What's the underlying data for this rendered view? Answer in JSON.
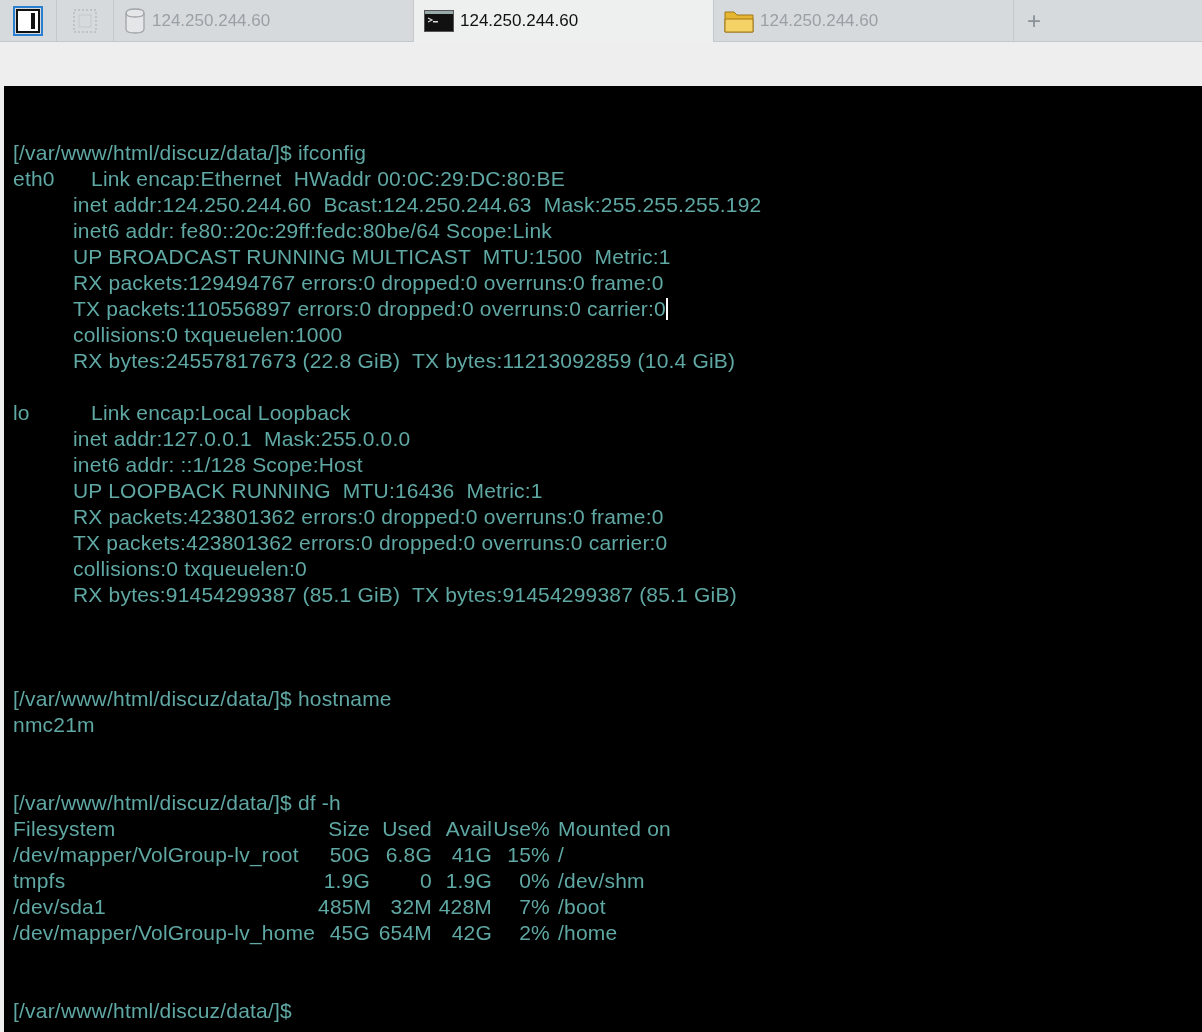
{
  "toolbar": [
    {
      "kind": "panel",
      "selected": true
    },
    {
      "kind": "select",
      "selected": false
    }
  ],
  "tabs": [
    {
      "kind": "database",
      "label": "124.250.244.60",
      "selected": false
    },
    {
      "kind": "terminal",
      "label": "124.250.244.60",
      "selected": true
    },
    {
      "kind": "folder",
      "label": "124.250.244.60",
      "selected": false
    }
  ],
  "new_tab": "+",
  "terminal": {
    "lines": [
      {
        "kind": "prompt",
        "prompt": "[/var/www/html/discuz/data/]$",
        "command": "ifconfig"
      },
      {
        "kind": "iface",
        "name": "eth0",
        "text": "Link encap:Ethernet  HWaddr 00:0C:29:DC:80:BE"
      },
      {
        "kind": "detail",
        "text": "inet addr:124.250.244.60  Bcast:124.250.244.63  Mask:255.255.255.192"
      },
      {
        "kind": "detail",
        "text": "inet6 addr: fe80::20c:29ff:fedc:80be/64 Scope:Link"
      },
      {
        "kind": "detail",
        "text": "UP BROADCAST RUNNING MULTICAST  MTU:1500  Metric:1"
      },
      {
        "kind": "detail",
        "text": "RX packets:129494767 errors:0 dropped:0 overruns:0 frame:0"
      },
      {
        "kind": "detail",
        "text": "TX packets:110556897 errors:0 dropped:0 overruns:0 carrier:0",
        "cursor": true
      },
      {
        "kind": "detail",
        "text": "collisions:0 txqueuelen:1000"
      },
      {
        "kind": "detail",
        "text": "RX bytes:24557817673 (22.8 GiB)  TX bytes:11213092859 (10.4 GiB)"
      },
      {
        "kind": "blank"
      },
      {
        "kind": "iface",
        "name": "lo",
        "text": "Link encap:Local Loopback"
      },
      {
        "kind": "detail",
        "text": "inet addr:127.0.0.1  Mask:255.0.0.0"
      },
      {
        "kind": "detail",
        "text": "inet6 addr: ::1/128 Scope:Host"
      },
      {
        "kind": "detail",
        "text": "UP LOOPBACK RUNNING  MTU:16436  Metric:1"
      },
      {
        "kind": "detail",
        "text": "RX packets:423801362 errors:0 dropped:0 overruns:0 frame:0"
      },
      {
        "kind": "detail",
        "text": "TX packets:423801362 errors:0 dropped:0 overruns:0 carrier:0"
      },
      {
        "kind": "detail",
        "text": "collisions:0 txqueuelen:0"
      },
      {
        "kind": "detail",
        "text": "RX bytes:91454299387 (85.1 GiB)  TX bytes:91454299387 (85.1 GiB)"
      },
      {
        "kind": "blank"
      },
      {
        "kind": "blank"
      },
      {
        "kind": "blank"
      },
      {
        "kind": "prompt",
        "prompt": "[/var/www/html/discuz/data/]$",
        "command": "hostname"
      },
      {
        "kind": "output",
        "text": "nmc21m"
      },
      {
        "kind": "blank"
      },
      {
        "kind": "blank"
      },
      {
        "kind": "prompt",
        "prompt": "[/var/www/html/discuz/data/]$",
        "command": "df -h"
      },
      {
        "kind": "row",
        "cells": [
          "Filesystem",
          "Size",
          "Used",
          "Avail",
          "Use%",
          "Mounted on"
        ]
      },
      {
        "kind": "row",
        "cells": [
          "/dev/mapper/VolGroup-lv_root",
          "50G",
          "6.8G",
          "41G",
          "15%",
          "/"
        ]
      },
      {
        "kind": "row",
        "cells": [
          "tmpfs",
          "1.9G",
          "0",
          "1.9G",
          "0%",
          "/dev/shm"
        ]
      },
      {
        "kind": "row",
        "cells": [
          "/dev/sda1",
          "485M",
          "32M",
          "428M",
          "7%",
          "/boot"
        ]
      },
      {
        "kind": "row",
        "cells": [
          "/dev/mapper/VolGroup-lv_home",
          "45G",
          "654M",
          "42G",
          "2%",
          "/home"
        ]
      },
      {
        "kind": "blank"
      },
      {
        "kind": "blank"
      },
      {
        "kind": "prompt",
        "prompt": "[/var/www/html/discuz/data/]$"
      }
    ]
  }
}
